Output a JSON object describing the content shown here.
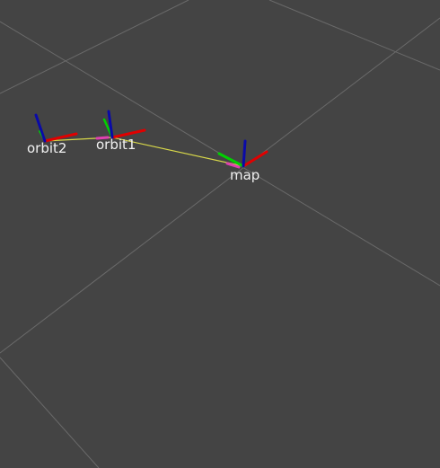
{
  "scene": {
    "background_color": "#444444",
    "grid_color": "#6a6a6a",
    "link_color": "#d8d84a",
    "axis_colors": {
      "x": "#e00000",
      "y": "#00d000",
      "z": "#0a0aa8"
    },
    "frames": [
      {
        "label": "orbit2"
      },
      {
        "label": "orbit1"
      },
      {
        "label": "map"
      }
    ]
  }
}
